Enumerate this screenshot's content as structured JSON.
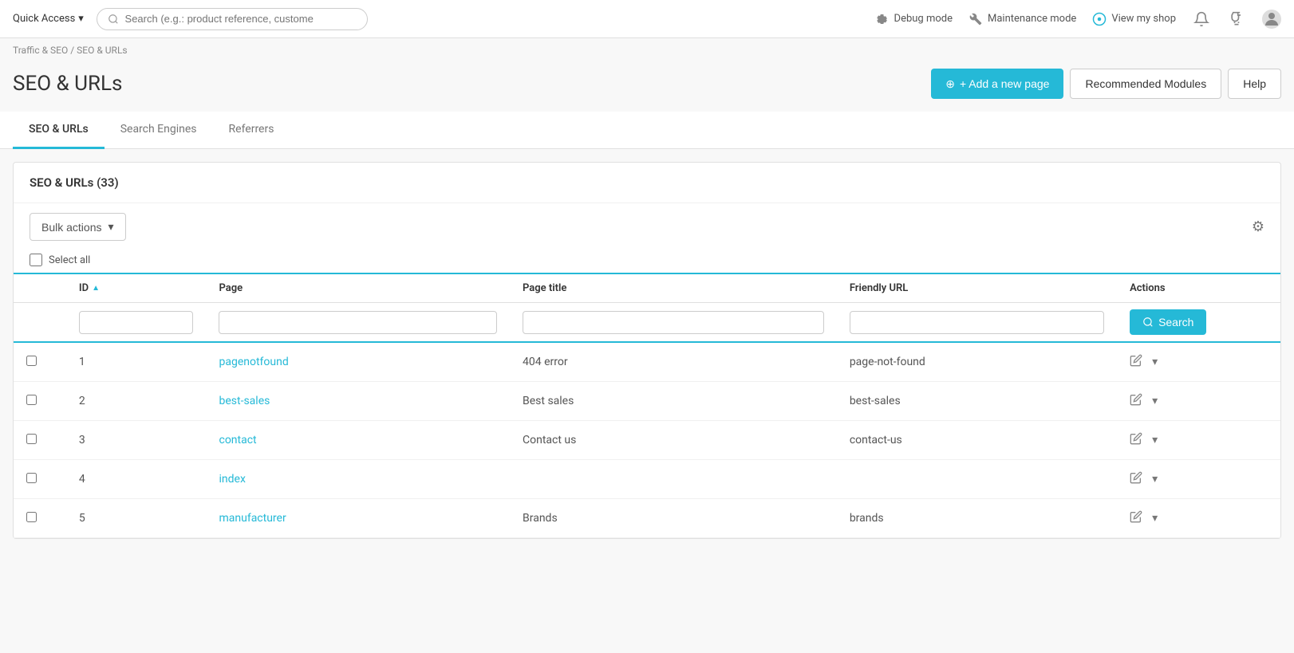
{
  "topNav": {
    "quickAccess": "Quick Access",
    "searchPlaceholder": "Search (e.g.: product reference, custome",
    "debugMode": "Debug mode",
    "maintenanceMode": "Maintenance mode",
    "viewMyShop": "View my shop"
  },
  "breadcrumb": {
    "parent": "Traffic & SEO",
    "separator": "/",
    "current": "SEO & URLs"
  },
  "pageHeader": {
    "title": "SEO & URLs",
    "addPageBtn": "+ Add a new page",
    "recommendedModules": "Recommended Modules",
    "help": "Help"
  },
  "tabs": [
    {
      "label": "SEO & URLs",
      "active": true
    },
    {
      "label": "Search Engines",
      "active": false
    },
    {
      "label": "Referrers",
      "active": false
    }
  ],
  "table": {
    "title": "SEO & URLs (33)",
    "bulkActions": "Bulk actions",
    "selectAll": "Select all",
    "searchBtn": "Search",
    "columns": {
      "id": "ID",
      "page": "Page",
      "pageTitle": "Page title",
      "friendlyUrl": "Friendly URL",
      "actions": "Actions"
    },
    "rows": [
      {
        "id": 1,
        "page": "pagenotfound",
        "pageTitle": "404 error",
        "friendlyUrl": "page-not-found"
      },
      {
        "id": 2,
        "page": "best-sales",
        "pageTitle": "Best sales",
        "friendlyUrl": "best-sales"
      },
      {
        "id": 3,
        "page": "contact",
        "pageTitle": "Contact us",
        "friendlyUrl": "contact-us"
      },
      {
        "id": 4,
        "page": "index",
        "pageTitle": "",
        "friendlyUrl": ""
      },
      {
        "id": 5,
        "page": "manufacturer",
        "pageTitle": "Brands",
        "friendlyUrl": "brands"
      }
    ]
  }
}
